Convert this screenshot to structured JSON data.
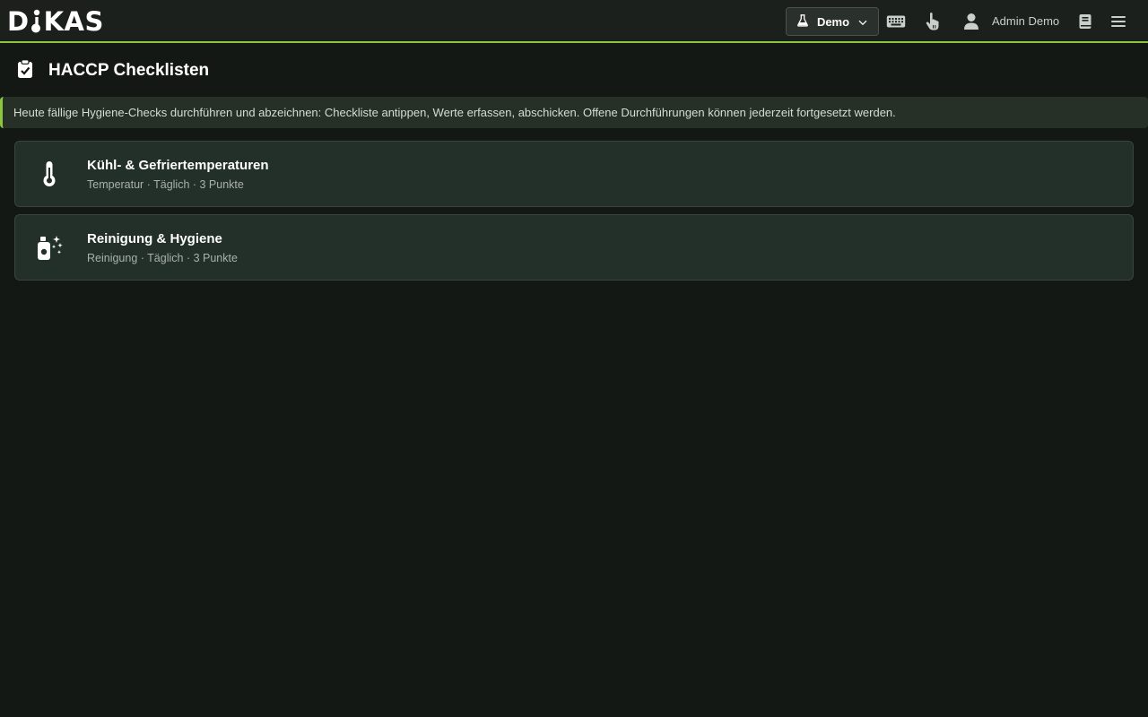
{
  "app": {
    "logo_text": "DIKAS",
    "logo_prefix": "D",
    "logo_suffix": "KAS"
  },
  "header": {
    "env_selector_label": "Demo",
    "user_name": "Admin Demo",
    "icons": [
      "flask-icon",
      "chevron-down-icon",
      "keyboard-icon",
      "touch-icon",
      "user-icon",
      "book-icon",
      "menu-icon"
    ]
  },
  "page": {
    "title": "HACCP Checklisten",
    "info_text": "Heute fällige Hygiene-Checks durchführen und abzeichnen: Checkliste antippen, Werte erfassen, abschicken. Offene Durchführungen können jederzeit fortgesetzt werden."
  },
  "checklists": [
    {
      "title": "Kühl- & Gefriertemperaturen",
      "category": "Temperatur",
      "frequency": "Täglich",
      "points": "3 Punkte",
      "meta": "Temperatur · Täglich · 3 Punkte",
      "icon": "thermometer-icon"
    },
    {
      "title": "Reinigung & Hygiene",
      "category": "Reinigung",
      "frequency": "Täglich",
      "points": "3 Punkte",
      "meta": "Reinigung · Täglich · 3 Punkte",
      "icon": "spray-bottle-icon"
    }
  ],
  "colors": {
    "accent": "#8cc63f",
    "background": "#141815",
    "topbar": "#1b201c",
    "card": "#233029"
  }
}
